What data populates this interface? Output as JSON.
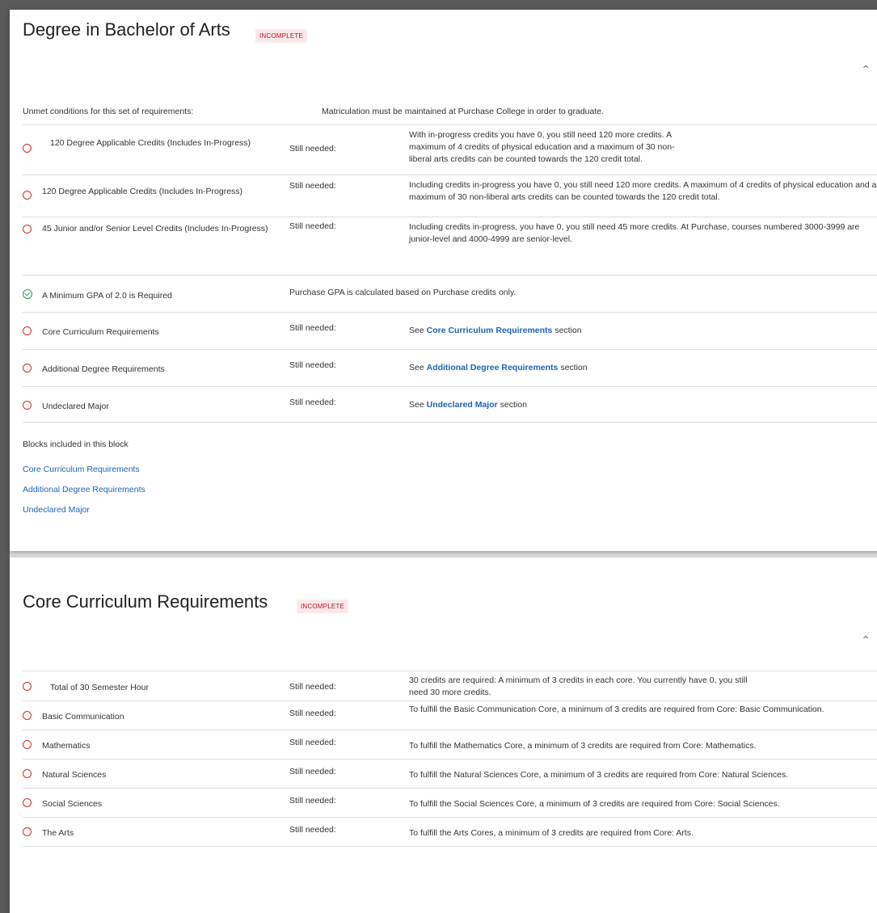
{
  "degree": {
    "title": "Degree in Bachelor of Arts",
    "badge": "INCOMPLETE",
    "unmet_label": "Unmet conditions for this set of requirements:",
    "unmet_text": "Matriculation must be maintained at Purchase College in order to graduate.",
    "still_needed": "Still needed:",
    "rows": [
      {
        "name": "120 Degree Applicable Credits (Includes In-Progress)",
        "status": "unmet",
        "desc": "With in-progress credits you have 0, you still need 120 more credits. A maximum of 4 credits of physical education and a maximum of 30 non-liberal arts credits can be counted towards the 120 credit total."
      },
      {
        "name": "120 Degree Applicable Credits (Includes In-Progress)",
        "status": "unmet",
        "desc": "Including credits in-progress you have 0, you still need 120 more credits. A maximum of 4 credits of physical education and a maximum of 30 non-liberal arts credits can be counted towards the 120 credit total."
      },
      {
        "name": "45 Junior and/or Senior Level Credits (Includes In-Progress)",
        "status": "unmet",
        "desc": "Including credits in-progress, you have 0, you still need 45 more credits. At Purchase, courses numbered 3000-3999 are junior-level and 4000-4999 are senior-level."
      },
      {
        "name": "A Minimum GPA of 2.0 is Required",
        "status": "met",
        "desc": "Purchase GPA is calculated based on Purchase credits only."
      },
      {
        "name": "Core Curriculum Requirements",
        "status": "unmet",
        "see": "See",
        "link": "Core Curriculum Requirements",
        "suffix": "section"
      },
      {
        "name": "Additional Degree Requirements",
        "status": "unmet",
        "see": "See",
        "link": "Additional Degree Requirements",
        "suffix": "section"
      },
      {
        "name": "Undeclared Major",
        "status": "unmet",
        "see": "See",
        "link": "Undeclared Major",
        "suffix": "section"
      }
    ],
    "blocks_heading": "Blocks included in this block",
    "blocks": [
      "Core Curriculum Requirements",
      "Additional Degree Requirements",
      "Undeclared Major"
    ]
  },
  "core": {
    "title": "Core Curriculum Requirements",
    "badge": "INCOMPLETE",
    "still_needed": "Still needed:",
    "rows": [
      {
        "name": "Total of 30 Semester Hour",
        "desc": "30 credits are required: A minimum of 3 credits in each core. You currently have 0, you still need 30 more credits."
      },
      {
        "name": "Basic Communication",
        "desc": "To fulfill the Basic Communication Core, a minimum of 3 credits are required from Core: Basic Communication."
      },
      {
        "name": "Mathematics",
        "desc": "To fulfill the Mathematics Core, a minimum of 3 credits are required from Core: Mathematics."
      },
      {
        "name": "Natural Sciences",
        "desc": "To fulfill the Natural Sciences Core, a minimum of 3 credits are required from Core: Natural Sciences."
      },
      {
        "name": "Social Sciences",
        "desc": "To fulfill the Social Sciences Core, a minimum of 3 credits are required from Core: Social Sciences."
      },
      {
        "name": "The Arts",
        "desc": "To fulfill the Arts Cores, a minimum of 3 credits are required from Core: Arts."
      }
    ]
  }
}
